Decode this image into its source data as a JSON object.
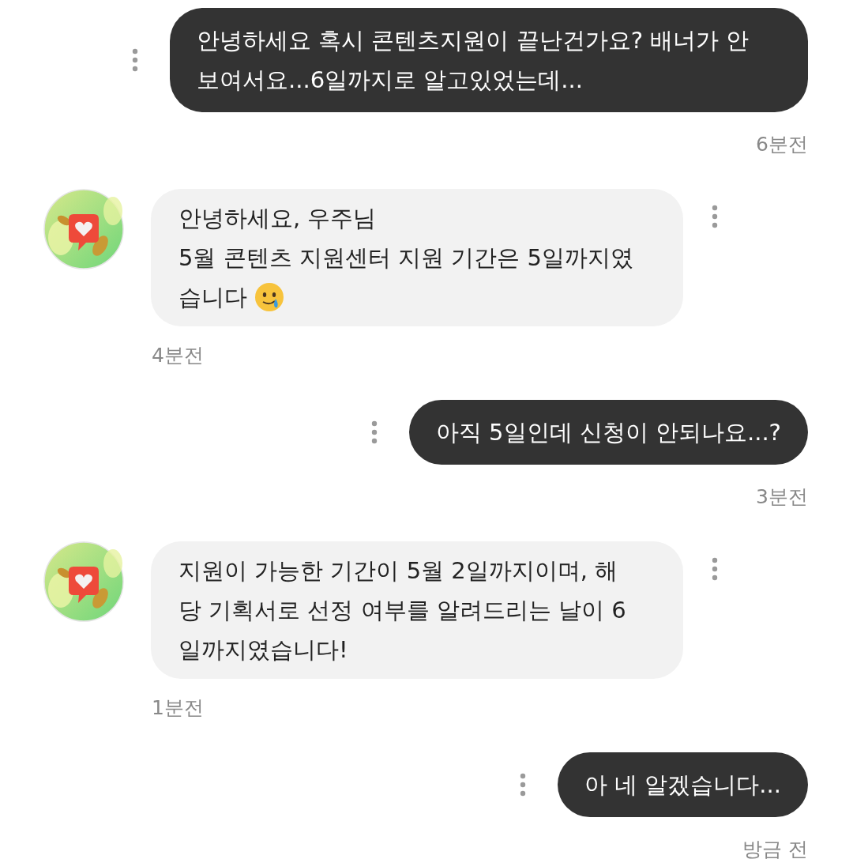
{
  "messages": [
    {
      "kind": "sent",
      "text": "안녕하세요 혹시 콘텐츠지원이 끝난건가요? 배너가 안 보여서요...6일까지로 알고있었는데...",
      "time": "6분전"
    },
    {
      "kind": "received",
      "lines": [
        "안녕하세요, 우주님",
        "5월 콘텐츠 지원센터 지원 기간은 5일까지였",
        "습니다"
      ],
      "trailing_emoji": true,
      "time": "4분전"
    },
    {
      "kind": "sent",
      "text": "아직 5일인데 신청이 안되나요...?",
      "time": "3분전"
    },
    {
      "kind": "received",
      "lines": [
        "지원이 가능한 기간이 5월 2일까지이며, 해",
        "당 기획서로 선정 여부를 알려드리는 날이 6",
        "일까지였습니다!"
      ],
      "trailing_emoji": false,
      "time": "1분전"
    },
    {
      "kind": "sent",
      "text": "아 네 알겠습니다...",
      "time": "방금 전"
    }
  ]
}
